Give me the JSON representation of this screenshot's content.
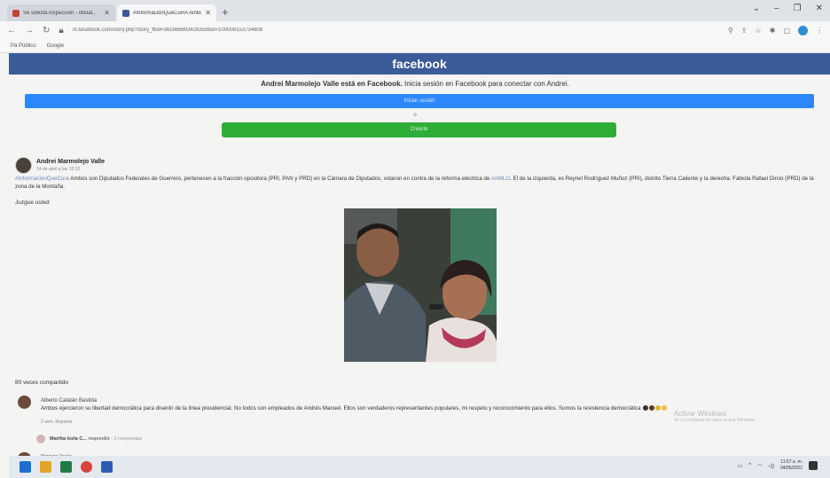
{
  "browser": {
    "tabs": [
      {
        "title": "Se solicita inspección - oficial...",
        "active": false
      },
      {
        "title": "#InformaciónQueCuRA Ambos s...",
        "active": true
      }
    ],
    "url": "m.facebook.com/story.php?story_fbid=3616686934263588id=100008153734608",
    "bookmarks": [
      "Pá Público",
      "Google"
    ]
  },
  "facebook": {
    "logo": "facebook",
    "login_message_bold": "Andrei Marmolejo Valle está en Facebook.",
    "login_message_rest": "Inicia sesión en Facebook para conectar con Andrei.",
    "login_button": "Iniciar sesión",
    "or_separator": "o",
    "register_button": "Crearte"
  },
  "post": {
    "author": "Andrei Marmolejo Valle",
    "date": "14 de abril a las 12:10",
    "hashtag": "#InformaciónQueCura",
    "text_part1": "Ambos son Diputados Federales de Guerrero, pertenecen a la fracción opositora (PRI, PAN y PRD) en la Cámara de Diputados, votaron en contra de la reforma eléctrica de",
    "mention": "#AMLO",
    "text_part2": ". El de la izquierda, es Reynel Rodríguez Muñoz (PRI), distrito Tierra Caliente y la derecha: Fabiola Rafael Dircio (PRD) de la zona de la Montaña.",
    "follow_up": "Juzgue usted",
    "shares": "80 veces compartido"
  },
  "comment": {
    "author": "Alberto Catalán Bastida",
    "text": "Ambos ejercieron su libertad democrática para disentir de la línea presidencial. No todos son empleados de Andrés Manuel. Ellos son verdaderos representantes populares, mi respeto y reconocimiento para ellos. Somos la resistencia democrática",
    "meta": "2 sem.   Reportar",
    "reply_author": "Martha Icela C...",
    "reply_action": "respondió",
    "reply_count": "· 3 respuestas",
    "next_author": "Marisera Varela"
  },
  "watermark": {
    "line1": "Activar Windows",
    "line2": "Ve a Configuración para activar Windows."
  },
  "taskbar": {
    "time": "11:57 a. m.",
    "date": "04/05/2022"
  }
}
